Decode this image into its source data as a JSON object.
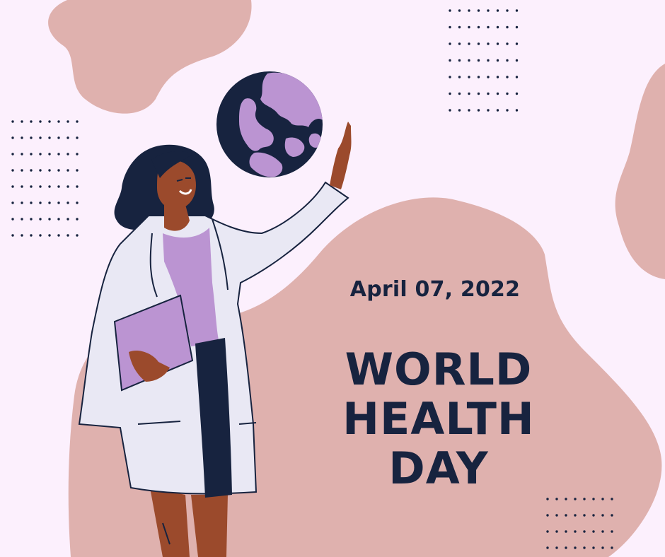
{
  "poster": {
    "date": "April 07, 2022",
    "title_lines": [
      "WORLD",
      "HEALTH",
      "DAY"
    ]
  },
  "colors": {
    "background": "#fcf0fd",
    "blob": "#dfb1ae",
    "navy": "#17233f",
    "lavender": "#bb94d2",
    "skin": "#9b4a2c",
    "coat": "#e9e8f4"
  },
  "icons": {
    "globe": "globe-icon",
    "dots": "dot-grid-pattern"
  }
}
